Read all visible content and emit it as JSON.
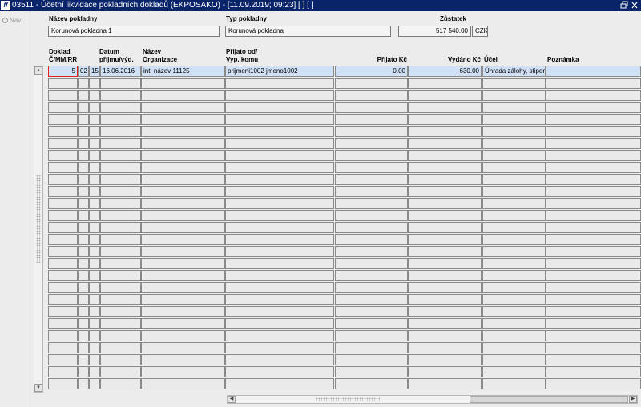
{
  "window": {
    "app_icon": "ff",
    "title": "03511 - Účetní likvidace pokladních dokladů (EKPOSAKO) - [11.09.2019; 09:23]  [ ]  [ ]",
    "icons": [
      "restore-icon",
      "close-icon"
    ]
  },
  "nav": {
    "label": "Nav",
    "icon": "nav-icon"
  },
  "header": {
    "pokladna_label": "Název pokladny",
    "pokladna_value": "Korunová pokladna 1",
    "typ_label": "Typ pokladny",
    "typ_value": "Korunová pokladna",
    "zustatek_label": "Zůstatek",
    "zustatek_value": "517 540.00",
    "mena_value": "CZK"
  },
  "table": {
    "headers": {
      "doklad_1": "Doklad",
      "doklad_2": "Č/MM/RR",
      "datum_1": "Datum",
      "datum_2": "příjmu/výd.",
      "nazev_1": "Název",
      "nazev_2": "Organizace",
      "prijato_od_1": "Přijato od/",
      "prijato_od_2": "Vyp. komu",
      "prijato_kc": "Přijato Kč",
      "vydano_kc": "Vydáno Kč",
      "ucel": "Účel",
      "poznamka": "Poznámka"
    },
    "rows": [
      {
        "cislo": "5",
        "mm": "02",
        "rr": "15",
        "datum": "16.06.2016",
        "organizace": "int. název 11125",
        "komu": "prijmeni1002 jmeno1002",
        "prijato": "0.00",
        "vydano": "630.00",
        "ucel": "Úhrada zálohy, stipen",
        "poznamka": ""
      }
    ],
    "empty_rows": 26
  },
  "colors": {
    "titlebar": "#0a246a",
    "active_row": "#cfe0f7",
    "focus_border": "#e02020"
  }
}
